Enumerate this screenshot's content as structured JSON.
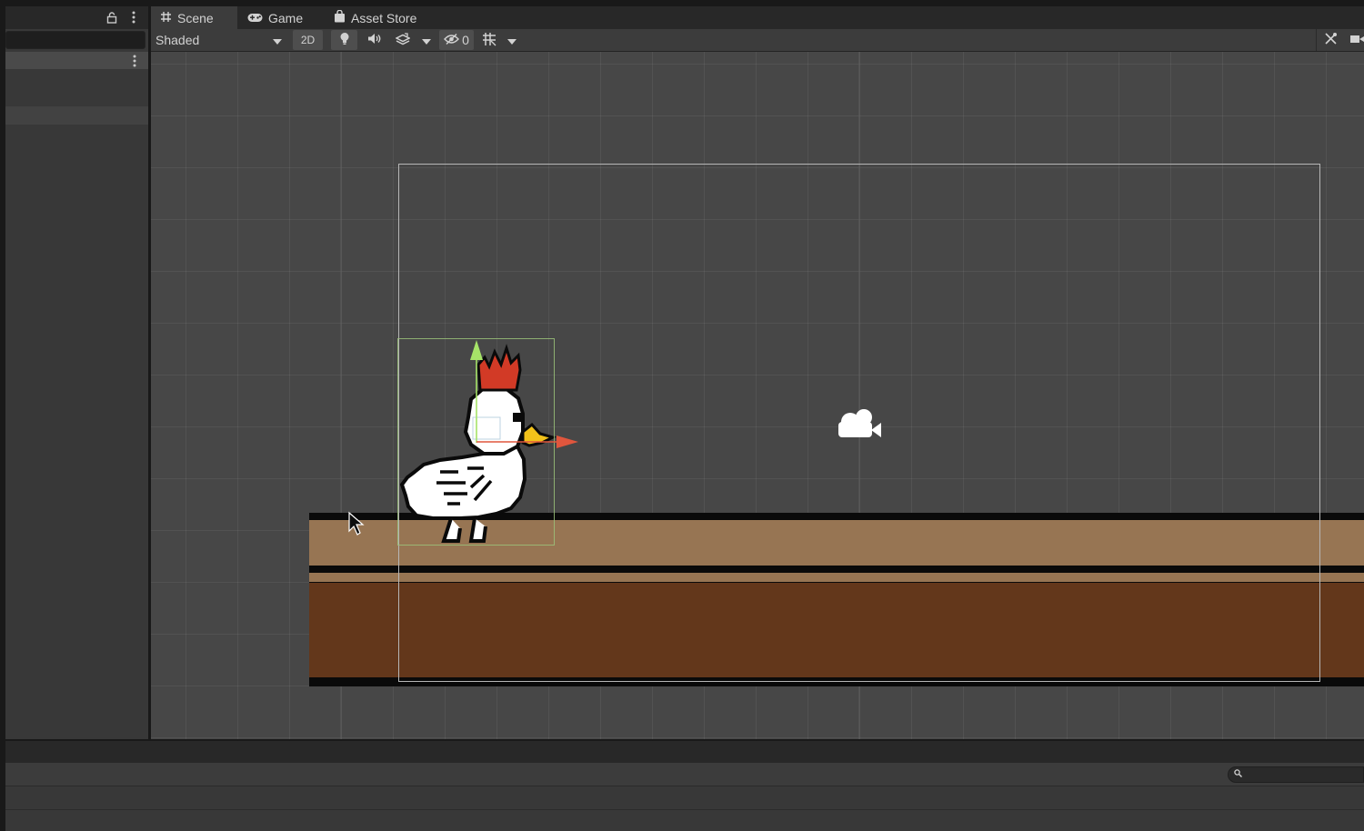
{
  "tabs": [
    {
      "label": "Scene",
      "icon": "grid-hash-icon",
      "active": true
    },
    {
      "label": "Game",
      "icon": "gamepad-icon",
      "active": false
    },
    {
      "label": "Asset Store",
      "icon": "shopping-bag-icon",
      "active": false
    }
  ],
  "toolbar": {
    "shading_mode": "Shaded",
    "mode_2d_label": "2D",
    "hidden_count": "0"
  },
  "colors": {
    "scene_bg": "#474747",
    "ground_top": "#977553",
    "ground_bottom": "#63371b",
    "outline": "#0a0a0a",
    "gizmo_y": "#a6e368",
    "gizmo_x": "#e0563d",
    "crown": "#d23a26",
    "beak": "#f2c21a"
  },
  "icons": {
    "lock": "lock-icon",
    "kebab": "kebab-menu-icon",
    "camera": "camera-gizmo-icon",
    "cursor": "mouse-cursor-icon",
    "search": "search-icon"
  }
}
